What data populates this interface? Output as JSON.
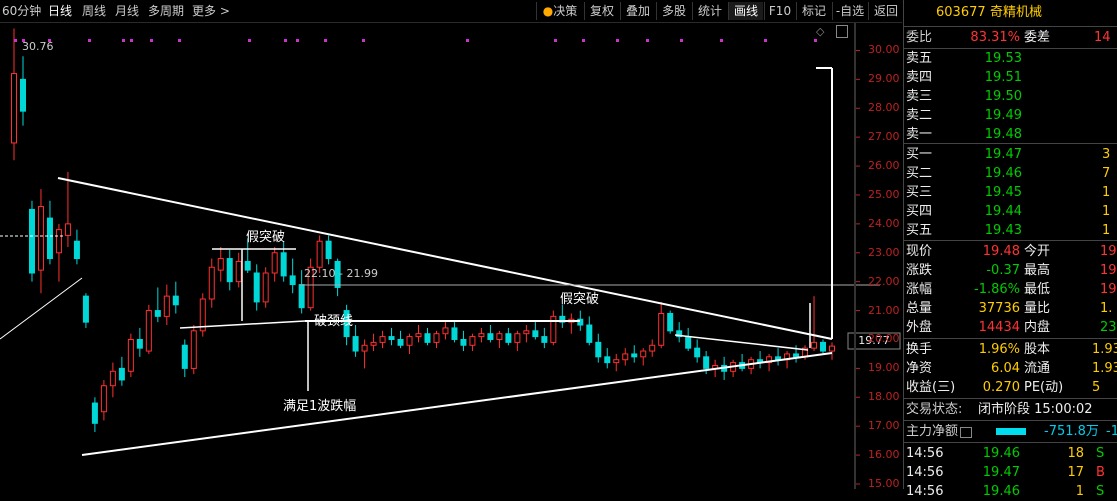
{
  "toolbar": {
    "left": [
      "60分钟",
      "日线",
      "周线",
      "月线",
      "多周期",
      "更多"
    ],
    "right": [
      "决策",
      "复权",
      "叠加",
      "多股",
      "统计",
      "画线",
      "F10",
      "标记",
      "-自选",
      "返回"
    ]
  },
  "stock": {
    "code": "603677",
    "name": "奇精机械"
  },
  "weibi": {
    "label": "委比",
    "value": "83.31%",
    "label2": "委差",
    "value2": "14"
  },
  "asks": [
    {
      "label": "卖五",
      "price": "19.53"
    },
    {
      "label": "卖四",
      "price": "19.51"
    },
    {
      "label": "卖三",
      "price": "19.50"
    },
    {
      "label": "卖二",
      "price": "19.49"
    },
    {
      "label": "卖一",
      "price": "19.48"
    }
  ],
  "bids": [
    {
      "label": "买一",
      "price": "19.47",
      "vol": "3"
    },
    {
      "label": "买二",
      "price": "19.46",
      "vol": "7"
    },
    {
      "label": "买三",
      "price": "19.45",
      "vol": "1"
    },
    {
      "label": "买四",
      "price": "19.44",
      "vol": "1"
    },
    {
      "label": "买五",
      "price": "19.43",
      "vol": "1"
    }
  ],
  "quote": [
    {
      "l1": "现价",
      "v1": "19.48",
      "l2": "今开",
      "v2": "19."
    },
    {
      "l1": "涨跌",
      "v1": "-0.37",
      "l2": "最高",
      "v2": "19."
    },
    {
      "l1": "涨幅",
      "v1": "-1.86%",
      "l2": "最低",
      "v2": "19."
    },
    {
      "l1": "总量",
      "v1": "37736",
      "l2": "量比",
      "v2": "1."
    },
    {
      "l1": "外盘",
      "v1": "14434",
      "l2": "内盘",
      "v2": "233"
    }
  ],
  "finance": [
    {
      "l1": "换手",
      "v1": "1.96%",
      "l2": "股本",
      "v2": "1.93"
    },
    {
      "l1": "净资",
      "v1": "6.04",
      "l2": "流通",
      "v2": "1.93"
    },
    {
      "l1": "收益(三)",
      "v1": "0.270",
      "l2": "PE(动)",
      "v2": "5"
    }
  ],
  "status": {
    "label": "交易状态:",
    "value": "闭市阶段 15:00:02"
  },
  "mainflow": {
    "label": "主力净额",
    "value": "-751.8万",
    "extra": "-1"
  },
  "ticks": [
    {
      "time": "14:56",
      "price": "19.46",
      "vol": "18",
      "side": "S"
    },
    {
      "time": "14:56",
      "price": "19.47",
      "vol": "17",
      "side": "B"
    },
    {
      "time": "14:56",
      "price": "19.46",
      "vol": "1",
      "side": "S"
    }
  ],
  "chart_data": {
    "type": "candlestick",
    "yticks": [
      "30.00",
      "29.00",
      "28.00",
      "27.00",
      "26.00",
      "25.00",
      "24.00",
      "23.00",
      "22.00",
      "21.00",
      "20.00",
      "19.00",
      "18.00",
      "17.00",
      "16.00",
      "15.00"
    ],
    "ylim": [
      15.0,
      30.5
    ],
    "current_price_label": "19.77",
    "annotations": [
      "30.76",
      "假突破",
      "22.10 - 21.99",
      "破颈线",
      "假突破",
      "满足1波跌幅"
    ],
    "ohlc": [
      [
        26.8,
        30.76,
        26.2,
        29.2
      ],
      [
        29.0,
        29.8,
        27.4,
        27.9
      ],
      [
        24.5,
        24.8,
        22.0,
        22.3
      ],
      [
        22.4,
        25.2,
        21.6,
        24.6
      ],
      [
        24.2,
        24.8,
        22.6,
        22.8
      ],
      [
        23.0,
        24.0,
        22.0,
        23.8
      ],
      [
        23.6,
        25.8,
        23.2,
        24.0
      ],
      [
        23.4,
        23.8,
        22.6,
        22.8
      ],
      [
        21.5,
        21.6,
        20.4,
        20.6
      ],
      [
        17.8,
        18.0,
        16.8,
        17.1
      ],
      [
        17.5,
        18.6,
        17.2,
        18.4
      ],
      [
        18.4,
        19.2,
        18.0,
        18.9
      ],
      [
        19.0,
        19.4,
        18.4,
        18.6
      ],
      [
        18.9,
        20.2,
        18.7,
        20.0
      ],
      [
        20.0,
        20.4,
        19.4,
        19.7
      ],
      [
        19.6,
        21.2,
        19.5,
        21.0
      ],
      [
        21.0,
        21.8,
        20.6,
        20.8
      ],
      [
        20.8,
        21.9,
        20.5,
        21.5
      ],
      [
        21.5,
        22.0,
        20.9,
        21.2
      ],
      [
        19.8,
        20.0,
        18.7,
        19.0
      ],
      [
        19.0,
        20.5,
        18.8,
        20.3
      ],
      [
        20.3,
        21.6,
        20.1,
        21.4
      ],
      [
        21.4,
        22.8,
        21.1,
        22.5
      ],
      [
        22.4,
        23.2,
        22.0,
        22.8
      ],
      [
        22.8,
        23.1,
        21.7,
        22.0
      ],
      [
        22.0,
        23.0,
        21.8,
        22.7
      ],
      [
        22.7,
        23.5,
        22.3,
        22.4
      ],
      [
        22.3,
        22.6,
        21.0,
        21.3
      ],
      [
        21.3,
        22.5,
        21.1,
        22.3
      ],
      [
        22.3,
        23.2,
        22.0,
        23.0
      ],
      [
        23.0,
        23.4,
        22.0,
        22.2
      ],
      [
        22.2,
        22.8,
        21.6,
        21.9
      ],
      [
        21.9,
        22.4,
        20.9,
        21.1
      ],
      [
        21.1,
        22.8,
        21.0,
        22.5
      ],
      [
        22.5,
        23.6,
        22.3,
        23.4
      ],
      [
        23.4,
        23.6,
        22.6,
        22.8
      ],
      [
        22.7,
        22.8,
        21.5,
        21.8
      ],
      [
        21.0,
        21.2,
        19.8,
        20.1
      ],
      [
        20.1,
        20.5,
        19.4,
        19.6
      ],
      [
        19.6,
        20.0,
        19.0,
        19.8
      ],
      [
        19.8,
        20.2,
        19.6,
        19.9
      ],
      [
        19.9,
        20.3,
        19.7,
        20.1
      ],
      [
        20.1,
        20.4,
        19.8,
        20.0
      ],
      [
        20.0,
        20.3,
        19.7,
        19.8
      ],
      [
        19.8,
        20.2,
        19.5,
        20.1
      ],
      [
        20.1,
        20.5,
        19.9,
        20.2
      ],
      [
        20.2,
        20.4,
        19.8,
        19.9
      ],
      [
        19.9,
        20.3,
        19.7,
        20.2
      ],
      [
        20.2,
        20.6,
        20.0,
        20.4
      ],
      [
        20.4,
        20.6,
        19.9,
        20.0
      ],
      [
        20.0,
        20.3,
        19.6,
        19.8
      ],
      [
        19.8,
        20.2,
        19.6,
        20.1
      ],
      [
        20.1,
        20.4,
        19.9,
        20.2
      ],
      [
        20.2,
        20.5,
        19.9,
        20.0
      ],
      [
        20.0,
        20.3,
        19.7,
        20.2
      ],
      [
        20.2,
        20.4,
        19.8,
        19.9
      ],
      [
        19.9,
        20.3,
        19.6,
        20.2
      ],
      [
        20.2,
        20.5,
        19.9,
        20.3
      ],
      [
        20.3,
        20.6,
        20.0,
        20.1
      ],
      [
        20.1,
        20.4,
        19.7,
        19.9
      ],
      [
        19.9,
        21.0,
        19.8,
        20.8
      ],
      [
        20.8,
        21.2,
        20.4,
        20.6
      ],
      [
        20.6,
        20.9,
        20.2,
        20.7
      ],
      [
        20.7,
        21.0,
        20.3,
        20.5
      ],
      [
        20.5,
        20.8,
        19.8,
        19.9
      ],
      [
        19.9,
        20.2,
        19.2,
        19.4
      ],
      [
        19.4,
        19.7,
        19.0,
        19.2
      ],
      [
        19.2,
        19.5,
        18.9,
        19.3
      ],
      [
        19.3,
        19.7,
        19.1,
        19.5
      ],
      [
        19.5,
        19.8,
        19.2,
        19.4
      ],
      [
        19.4,
        19.7,
        19.1,
        19.6
      ],
      [
        19.6,
        20.0,
        19.4,
        19.8
      ],
      [
        19.8,
        21.3,
        19.7,
        20.9
      ],
      [
        20.9,
        21.0,
        20.2,
        20.3
      ],
      [
        20.3,
        20.6,
        19.9,
        20.1
      ],
      [
        20.1,
        20.4,
        19.6,
        19.7
      ],
      [
        19.7,
        20.0,
        19.2,
        19.4
      ],
      [
        19.4,
        19.6,
        18.8,
        19.0
      ],
      [
        19.0,
        19.3,
        18.7,
        19.1
      ],
      [
        19.1,
        19.4,
        18.6,
        18.9
      ],
      [
        18.9,
        19.3,
        18.7,
        19.2
      ],
      [
        19.2,
        19.5,
        18.9,
        19.0
      ],
      [
        19.0,
        19.4,
        18.8,
        19.3
      ],
      [
        19.3,
        19.6,
        19.0,
        19.2
      ],
      [
        19.2,
        19.5,
        18.9,
        19.4
      ],
      [
        19.4,
        19.7,
        19.1,
        19.3
      ],
      [
        19.3,
        19.6,
        19.0,
        19.5
      ],
      [
        19.5,
        19.8,
        19.2,
        19.4
      ],
      [
        19.4,
        19.8,
        19.3,
        19.7
      ],
      [
        19.7,
        21.5,
        19.6,
        19.9
      ],
      [
        19.9,
        20.0,
        19.5,
        19.6
      ],
      [
        19.6,
        19.9,
        19.3,
        19.77
      ]
    ]
  }
}
